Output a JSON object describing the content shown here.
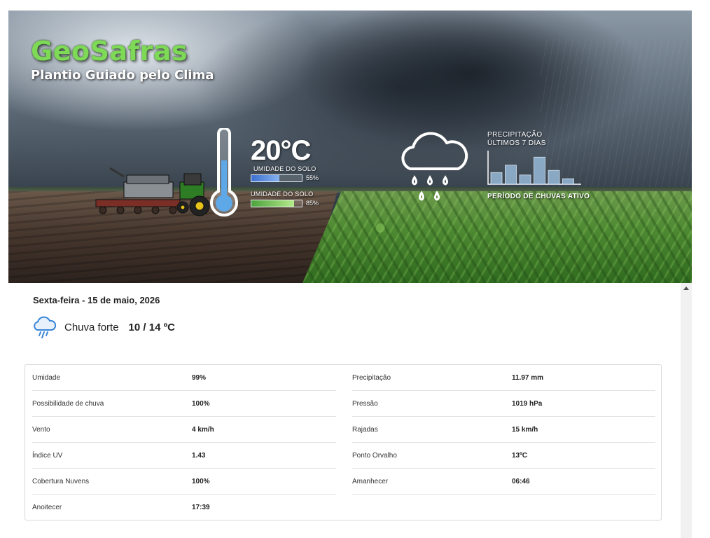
{
  "banner": {
    "brand_title": "GeoSafras",
    "brand_subtitle": "Plantio Guiado pelo Clima",
    "temperature": "20°C",
    "soil_moisture_1": {
      "label": "UMIDADE DO SOLO",
      "value": "55%",
      "fraction": 0.55
    },
    "soil_moisture_2": {
      "label": "UMIDADE DO SOLO",
      "value": "85%",
      "fraction": 0.85
    },
    "precip_title_line1": "PRECIPITAÇÃO",
    "precip_title_line2": "ÚLTIMOS 7 DIAS",
    "precip_bars": [
      0.38,
      0.62,
      0.3,
      0.88,
      0.45,
      0.18
    ],
    "precip_footer": "PERÍODO DE CHUVAS ATIVO",
    "colors": {
      "brand_green": "#7ed957",
      "bar_blue": "#4a7fd4",
      "bar_green": "#5cb54a"
    }
  },
  "forecast": {
    "date": "Sexta-feira - 15 de maio, 2026",
    "condition": "Chuva forte",
    "temp_range": "10 / 14 ºC",
    "condition_icon": "heavy-rain-cloud-icon"
  },
  "details": [
    {
      "label": "Umidade",
      "value": "99%"
    },
    {
      "label": "Precipitação",
      "value": "11.97 mm"
    },
    {
      "label": "Possibilidade de chuva",
      "value": "100%"
    },
    {
      "label": "Pressão",
      "value": "1019 hPa"
    },
    {
      "label": "Vento",
      "value": "4 km/h"
    },
    {
      "label": "Rajadas",
      "value": "15 km/h"
    },
    {
      "label": "Índice UV",
      "value": "1.43"
    },
    {
      "label": "Ponto Orvalho",
      "value": "13ºC"
    },
    {
      "label": "Cobertura Nuvens",
      "value": "100%"
    },
    {
      "label": "Amanhecer",
      "value": "06:46"
    },
    {
      "label": "Anoitecer",
      "value": "17:39"
    }
  ]
}
